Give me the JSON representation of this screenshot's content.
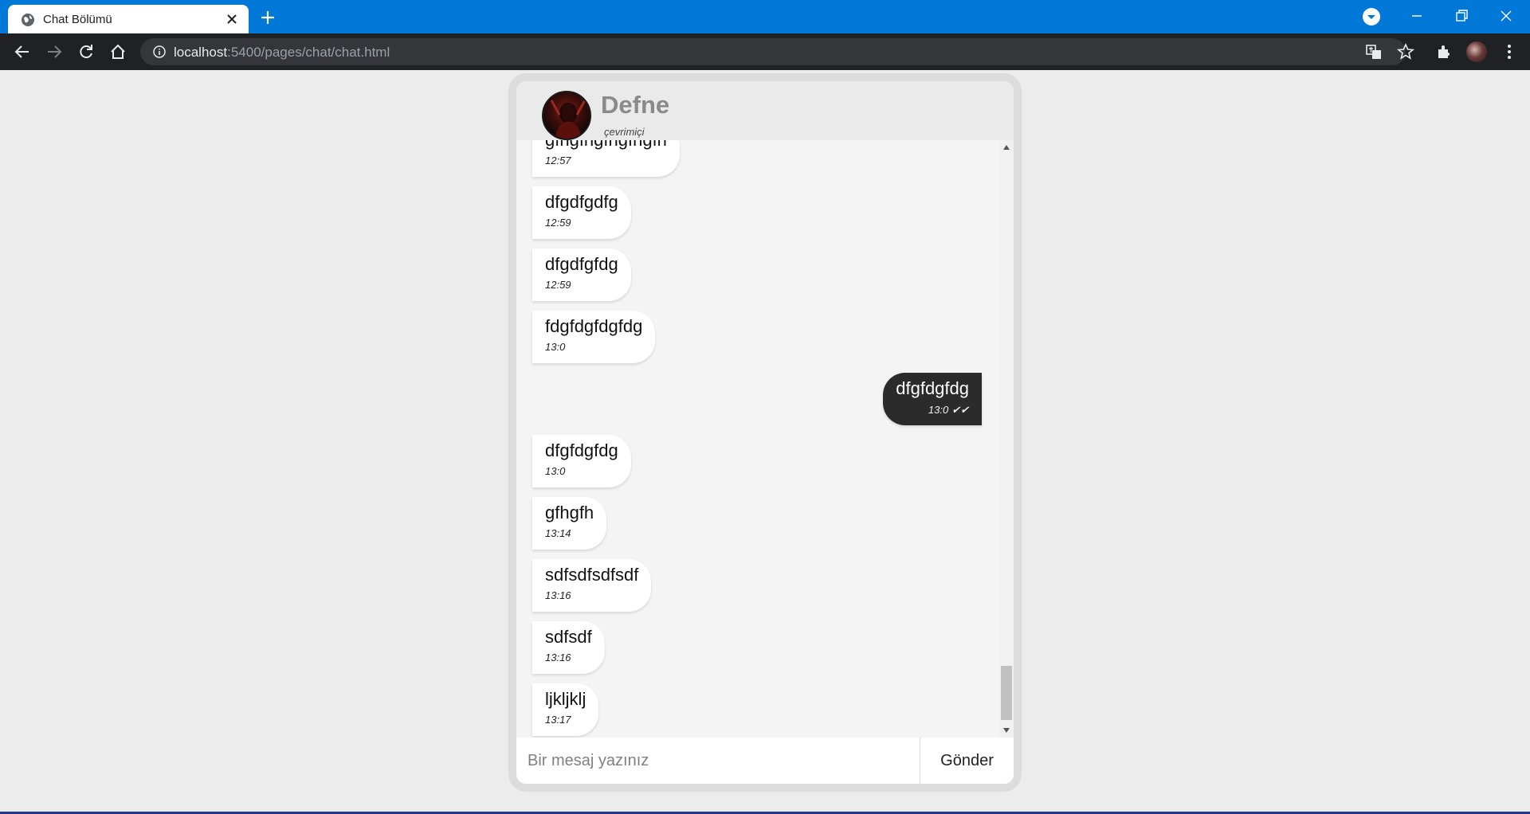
{
  "browser": {
    "tab_title": "Chat Bölümü",
    "url_host": "localhost",
    "url_rest": ":5400/pages/chat/chat.html"
  },
  "contact": {
    "name": "Defne",
    "status": "çevrimiçi"
  },
  "messages": [
    {
      "text": "gfhgfhgfhgfhgfh",
      "time": "12:57",
      "direction": "incoming"
    },
    {
      "text": "dfgdfgdfg",
      "time": "12:59",
      "direction": "incoming"
    },
    {
      "text": "dfgdfgfdg",
      "time": "12:59",
      "direction": "incoming"
    },
    {
      "text": "fdgfdgfdgfdg",
      "time": "13:0",
      "direction": "incoming"
    },
    {
      "text": "dfgfdgfdg",
      "time": "13:0",
      "direction": "outgoing",
      "ticks": "✔✔"
    },
    {
      "text": "dfgfdgfdg",
      "time": "13:0",
      "direction": "incoming"
    },
    {
      "text": "gfhgfh",
      "time": "13:14",
      "direction": "incoming"
    },
    {
      "text": "sdfsdfsdfsdf",
      "time": "13:16",
      "direction": "incoming"
    },
    {
      "text": "sdfsdf",
      "time": "13:16",
      "direction": "incoming"
    },
    {
      "text": "ljkljklj",
      "time": "13:17",
      "direction": "incoming"
    }
  ],
  "composer": {
    "placeholder": "Bir mesaj yazınız",
    "send_label": "Gönder"
  },
  "colors": {
    "titlebar": "#0078d7",
    "toolbar": "#202124",
    "outgoing_bubble": "#2b2b2b",
    "incoming_bubble": "#ffffff"
  }
}
